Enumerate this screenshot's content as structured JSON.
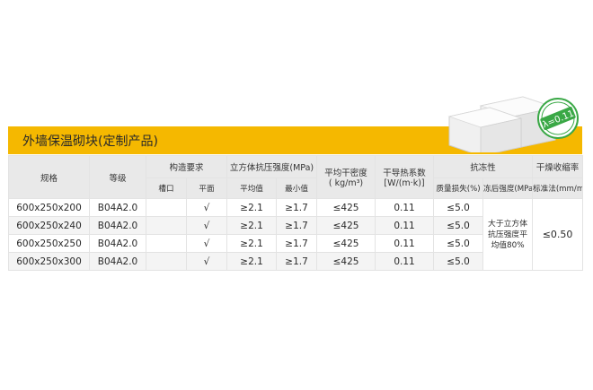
{
  "title": "外墙保温砌块(定制产品)",
  "badge": "λ=0.11",
  "headers": {
    "spec": "规格",
    "grade": "等级",
    "structure": "构造要求",
    "groove": "槽口",
    "flat": "平面",
    "strength": "立方体抗压强度(MPa)",
    "avg": "平均值",
    "min": "最小值",
    "density_line1": "平均干密度",
    "density_line2": "( kg/m³)",
    "conductivity_line1": "干导热系数",
    "conductivity_line2": "[W/(m·k)]",
    "frost": "抗冻性",
    "mass_loss": "质量损失(%)",
    "post_freeze": "冻后强度(MPa)",
    "shrinkage": "干燥收缩率",
    "standard": "标准法(mm/m)"
  },
  "rows": [
    {
      "spec": "600x250x200",
      "grade": "B04A2.0",
      "groove": "",
      "flat": "√",
      "avg": "≥2.1",
      "min": "≥1.7",
      "density": "≤425",
      "conductivity": "0.11",
      "mass_loss": "≤5.0"
    },
    {
      "spec": "600x250x240",
      "grade": "B04A2.0",
      "groove": "",
      "flat": "√",
      "avg": "≥2.1",
      "min": "≥1.7",
      "density": "≤425",
      "conductivity": "0.11",
      "mass_loss": "≤5.0"
    },
    {
      "spec": "600x250x250",
      "grade": "B04A2.0",
      "groove": "",
      "flat": "√",
      "avg": "≥2.1",
      "min": "≥1.7",
      "density": "≤425",
      "conductivity": "0.11",
      "mass_loss": "≤5.0"
    },
    {
      "spec": "600x250x300",
      "grade": "B04A2.0",
      "groove": "",
      "flat": "√",
      "avg": "≥2.1",
      "min": "≥1.7",
      "density": "≤425",
      "conductivity": "0.11",
      "mass_loss": "≤5.0"
    }
  ],
  "post_freeze_value_lines": [
    "大于立方体",
    "抗压强度平",
    "均值80%"
  ],
  "shrinkage_value": "≤0.50",
  "colors": {
    "title_bar": "#f5b800",
    "header_bg": "#e9e9e9",
    "badge_green": "#3aa846"
  }
}
